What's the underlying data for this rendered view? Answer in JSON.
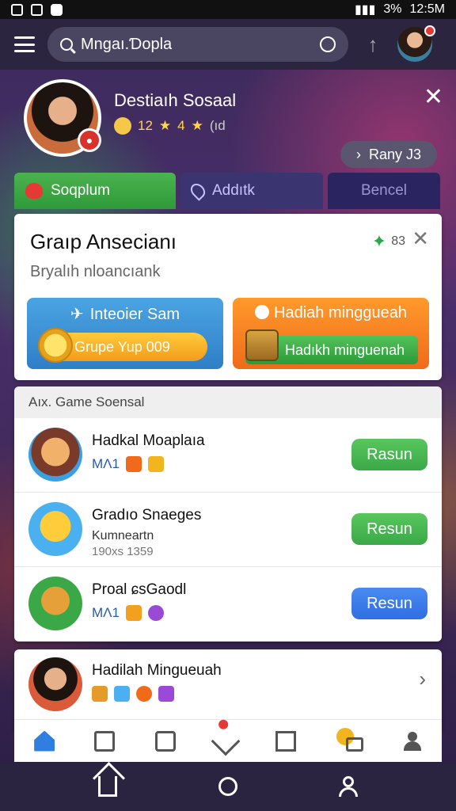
{
  "status": {
    "time": "12:5M",
    "battery": "%",
    "signal": "3%"
  },
  "search": {
    "value": "Mngaı.Ɗopla"
  },
  "profile": {
    "name": "Destiaıh Sosaal",
    "stats": [
      "12",
      "★",
      "4",
      "★",
      "(ıd"
    ],
    "rank_label": "Rany J3"
  },
  "tabs": [
    {
      "label": "Soqplum"
    },
    {
      "label": "Addıtk"
    },
    {
      "label": "Bencel"
    }
  ],
  "card1": {
    "title": "Graıp Ansecianı",
    "subtitle": "Bryalıh nloancıank",
    "count": "83",
    "promo_blue": {
      "top": "Inteoier Sam",
      "bar": "Grupe Yup 009"
    },
    "promo_orange": {
      "top": "Hadiah minggueah",
      "bar": "Hadıkh minguenah"
    }
  },
  "card2": {
    "header": "Aıx. Game Soensal",
    "rows": [
      {
        "title": "Hadkal Moaplaıa",
        "sub": "MΛ1",
        "sub2": "",
        "button": "Rasun",
        "button_color": "#3aa846"
      },
      {
        "title": "Gradıo Snaeges",
        "sub": "Kumneartn",
        "sub2": "190xs 1359",
        "button": "Resun",
        "button_color": "#3aa846"
      },
      {
        "title": "Proal ɕsGaodl",
        "sub": "MΛ1",
        "sub2": "",
        "button": "Resun",
        "button_color": "#2f6ee0"
      }
    ]
  },
  "card3": {
    "title": "Hadilah Mingueuah"
  },
  "icons": {
    "top_menu": "hamburger-icon",
    "search": "search-icon",
    "mic": "mic-icon",
    "nav": [
      "home-icon",
      "book-icon",
      "document-icon",
      "pen-icon",
      "box-icon",
      "coin-icon",
      "user-icon"
    ]
  }
}
